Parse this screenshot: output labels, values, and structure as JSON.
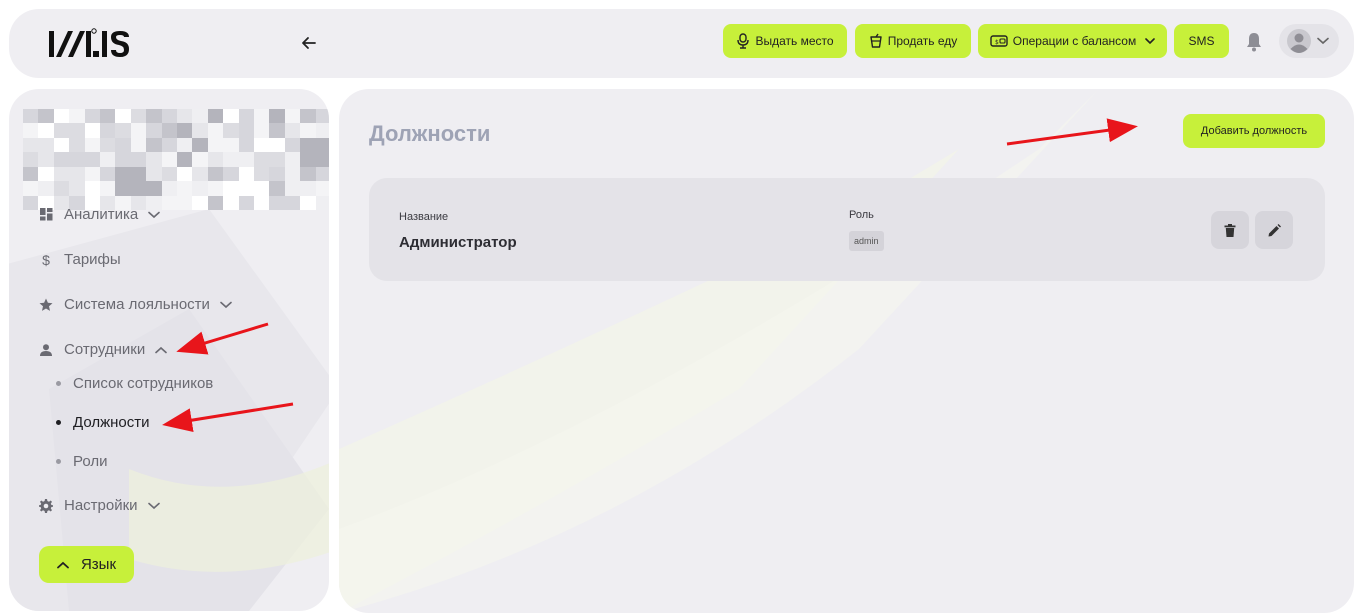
{
  "header": {
    "logo_text": "ICI.IS",
    "buttons": {
      "give_seat": "Выдать место",
      "sell_food": "Продать еду",
      "balance_ops": "Операции с балансом",
      "sms": "SMS"
    }
  },
  "sidebar": {
    "items": {
      "analytics": "Аналитика",
      "tariffs": "Тарифы",
      "loyalty": "Система лояльности",
      "employees": "Сотрудники",
      "settings": "Настройки"
    },
    "sub_items": {
      "employee_list": "Список сотрудников",
      "positions": "Должности",
      "roles": "Роли"
    },
    "language_button": "Язык"
  },
  "main": {
    "title": "Должности",
    "add_button": "Добавить должность",
    "card": {
      "name_label": "Название",
      "name_value": "Администратор",
      "role_label": "Роль",
      "role_value": "admin"
    }
  },
  "colors": {
    "accent": "#c7f03a",
    "panel": "#efeef2",
    "arrow": "#e8151b"
  }
}
